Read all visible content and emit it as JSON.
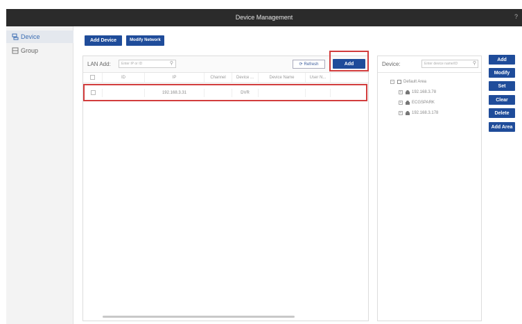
{
  "window": {
    "title": "Device Management",
    "help_glyph": "?"
  },
  "sidebar": {
    "items": [
      {
        "label": "Device",
        "icon": "device-icon",
        "active": true
      },
      {
        "label": "Group",
        "icon": "group-icon",
        "active": false
      }
    ]
  },
  "toolbar": {
    "add_device_label": "Add Device",
    "modify_network_label": "Modify Network"
  },
  "lan": {
    "label": "LAN Add:",
    "search_placeholder": "Enter IP or ID",
    "refresh_label": "Refresh",
    "add_label": "Add",
    "columns": [
      "",
      "ID",
      "IP",
      "Channel",
      "Device ...",
      "Device Name",
      "User N..."
    ],
    "rows": [
      {
        "id": "",
        "ip": "192.168.3.31",
        "channel": "",
        "device_type": "DVR",
        "device_name": "",
        "user_name": ""
      }
    ]
  },
  "device_panel": {
    "label": "Device:",
    "search_placeholder": "Enter device name/ID",
    "tree": {
      "root": "Default Area",
      "children": [
        "192.168.3.78",
        "ECGSPARK",
        "192.168.3.178"
      ]
    }
  },
  "actions": [
    "Add",
    "Modify",
    "Set",
    "Clear",
    "Delete",
    "Add Area"
  ],
  "colors": {
    "titlebar": "#2b2b2b",
    "button_blue": "#1f4c9a",
    "highlight_red": "#d23c3c",
    "sidebar_active_text": "#3b6db3"
  }
}
